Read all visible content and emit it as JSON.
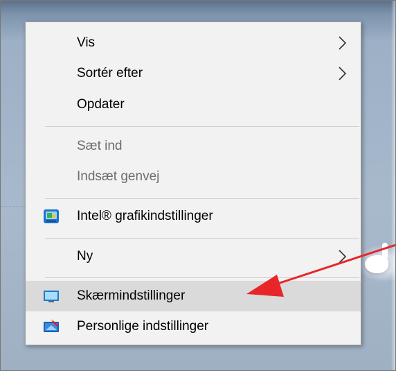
{
  "context_menu": {
    "items": [
      {
        "label": "Vis",
        "submenu": true,
        "disabled": false
      },
      {
        "label": "Sortér efter",
        "submenu": true,
        "disabled": false
      },
      {
        "label": "Opdater",
        "submenu": false,
        "disabled": false
      },
      {
        "label": "Sæt ind",
        "submenu": false,
        "disabled": true
      },
      {
        "label": "Indsæt genvej",
        "submenu": false,
        "disabled": true
      },
      {
        "label": "Intel® grafikindstillinger",
        "submenu": false,
        "disabled": false,
        "icon": "intel-graphics-icon"
      },
      {
        "label": "Ny",
        "submenu": true,
        "disabled": false
      },
      {
        "label": "Skærmindstillinger",
        "submenu": false,
        "disabled": false,
        "icon": "display-settings-icon",
        "highlighted": true
      },
      {
        "label": "Personlige indstillinger",
        "submenu": false,
        "disabled": false,
        "icon": "personalize-icon"
      }
    ]
  },
  "annotation": {
    "color": "#e8262a",
    "icon": "red-arrow"
  },
  "colors": {
    "menu_bg": "#f2f2f2",
    "highlight_bg": "#dadada",
    "disabled_text": "#6d6d6d"
  }
}
